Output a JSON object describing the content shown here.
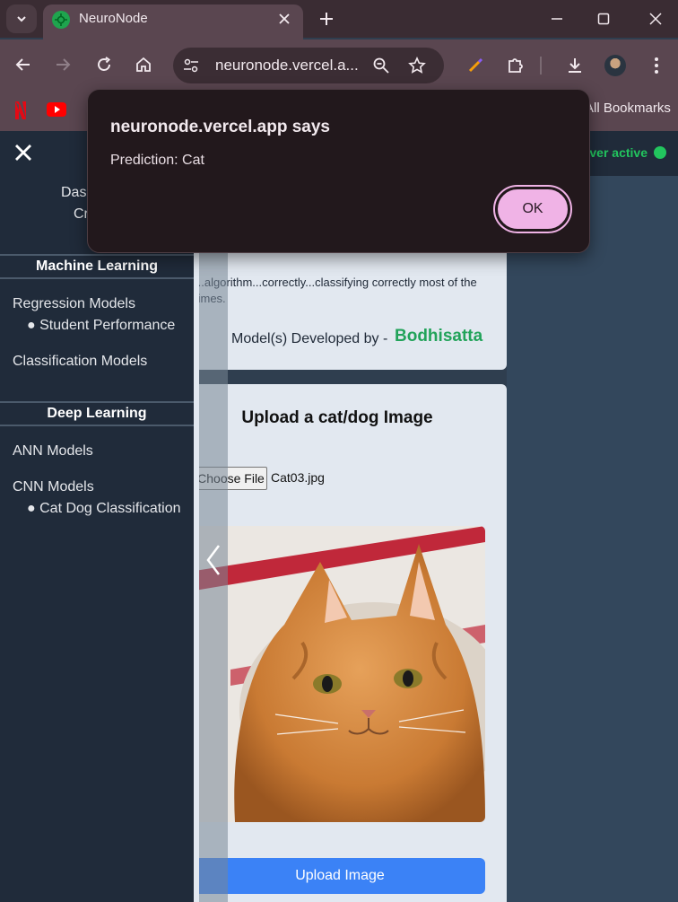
{
  "browser": {
    "tab_title": "NeuroNode",
    "url": "neuronode.vercel.a...",
    "all_bookmarks": "All Bookmarks"
  },
  "dialog": {
    "title": "neuronode.vercel.app says",
    "message": "Prediction: Cat",
    "ok_label": "OK"
  },
  "header": {
    "server_status": "Server active"
  },
  "sidebar": {
    "links": [
      "Dashboard",
      "Create"
    ],
    "ml_section": "Machine Learning",
    "regression": "Regression Models",
    "regression_sub": "● Student Performance",
    "classification": "Classification Models",
    "dl_section": "Deep Learning",
    "ann": "ANN Models",
    "cnn": "CNN Models",
    "cnn_sub": "● Cat Dog Classification"
  },
  "card_info": {
    "description_tail": "...algorithm...correctly...classifying correctly most of the times.",
    "developed_by": "Model(s) Developed by -",
    "developer": "Bodhisatta"
  },
  "upload_card": {
    "heading": "Upload a cat/dog Image",
    "choose_file": "Choose File",
    "file_name": "Cat03.jpg",
    "upload_button": "Upload Image"
  },
  "colors": {
    "accent_green": "#22c55e",
    "button_blue": "#3b82f6",
    "dialog_ok": "#f0b3e6"
  }
}
